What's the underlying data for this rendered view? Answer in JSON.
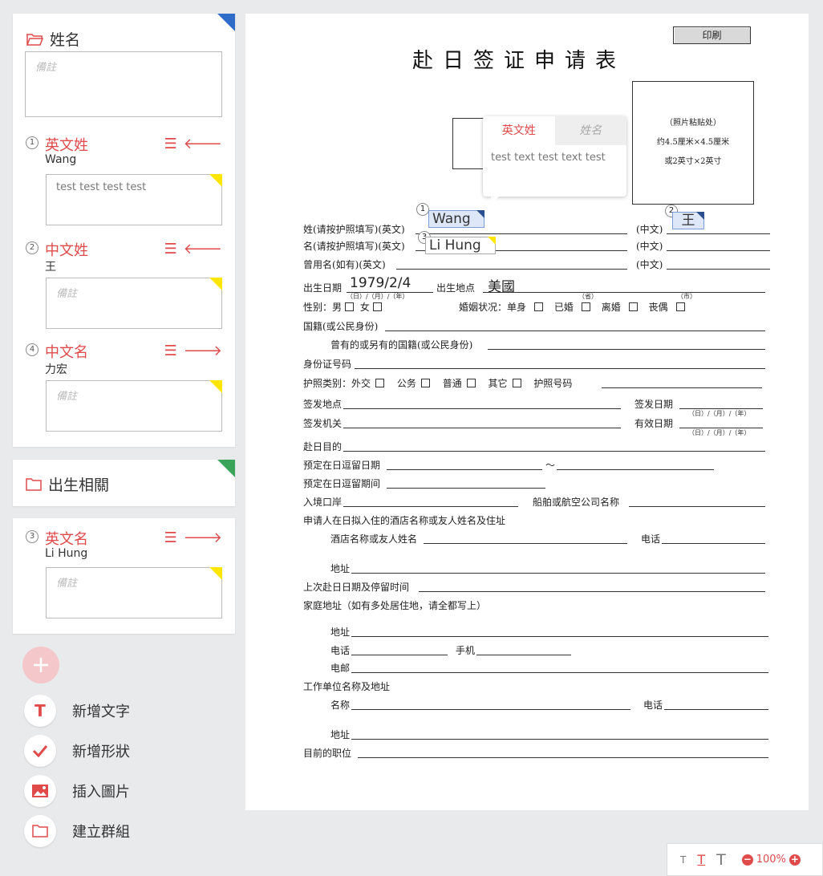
{
  "left_panel": {
    "group1": {
      "title": "姓名",
      "corner_color": "#2f6cc9",
      "note_placeholder": "備註",
      "fields": [
        {
          "num": "1",
          "name": "英文姓",
          "value": "Wang",
          "note": "test test test test",
          "note_filled": true,
          "action_icon": "arrow-left-icon"
        },
        {
          "num": "2",
          "name": "中文姓",
          "value": "王",
          "note": "備註",
          "note_filled": false,
          "action_icon": "arrow-left-icon"
        },
        {
          "num": "4",
          "name": "中文名",
          "value": "力宏",
          "note": "備註",
          "note_filled": false,
          "action_icon": "arrow-right-icon"
        }
      ]
    },
    "group2": {
      "title": "出生相關",
      "corner_color": "#3aa55a"
    },
    "single_field": {
      "num": "3",
      "name": "英文名",
      "value": "Li Hung",
      "note": "備註",
      "action_icon": "arrow-right-icon"
    },
    "actions": [
      {
        "label": "新增文字",
        "icon": "text-T-icon"
      },
      {
        "label": "新增形狀",
        "icon": "check-icon"
      },
      {
        "label": "插入圖片",
        "icon": "image-icon"
      },
      {
        "label": "建立群組",
        "icon": "folder-icon"
      }
    ]
  },
  "document": {
    "print_button": "印刷",
    "title": "赴日签证申请表",
    "photo_box": [
      "（照片粘贴处）",
      "约4.5厘米×4.5厘米",
      "或2英寸×2英寸"
    ],
    "labels": {
      "surname_en": "姓(请按护照填写)(英文)",
      "surname_cn": "(中文)",
      "given_en": "名(请按护照填写)(英文)",
      "given_cn": "(中文)",
      "former_en": "曾用名(如有)(英文)",
      "former_cn": "(中文)",
      "birth_date": "出生日期",
      "birth_place": "出生地点",
      "date_sub": "（日）/（月）/（年）",
      "prov_sub": "（省）",
      "city_sub": "（市）",
      "gender": "性别：男",
      "female": "女",
      "marital": "婚姻状况：单身",
      "married": "已婚",
      "divorced": "离婚",
      "widowed": "丧偶",
      "nationality": "国籍(或公民身份)",
      "former_nationality": "曾有的或另有的国籍(或公民身份)",
      "id_number": "身份证号码",
      "passport_type": "护照类别：外交",
      "official": "公务",
      "ordinary": "普通",
      "other": "其它",
      "passport_no": "护照号码",
      "issue_place": "签发地点",
      "issue_date": "签发日期",
      "issuing_authority": "签发机关",
      "valid_date": "有效日期",
      "dmy": "（日）/（月）/（年）",
      "purpose": "赴日目的",
      "stay_date": "预定在日逗留日期",
      "tilde": "～",
      "stay_period": "预定在日逗留期间",
      "port": "入境口岸",
      "ship": "船舶或航空公司名称",
      "hotel_title": "申请人在日拟入住的酒店名称或友人姓名及住址",
      "hotel_name": "酒店名称或友人姓名",
      "phone": "电话",
      "address": "地址",
      "last_visit": "上次赴日日期及停留时间",
      "home_address": "家庭地址（如有多处居住地，请全都写上）",
      "home_addr": "地址",
      "home_phone": "电话",
      "mobile": "手机",
      "email": "电邮",
      "work_title": "工作单位名称及地址",
      "work_name": "名称",
      "work_phone": "电话",
      "work_addr": "地址",
      "position": "目前的职位"
    },
    "handwritten": {
      "birth_date": "1979/2/4",
      "birth_place": "美國"
    },
    "overlays": [
      {
        "num": "1",
        "value": "Wang"
      },
      {
        "num": "2",
        "value": "王"
      },
      {
        "num": "3",
        "value": "Li Hung"
      }
    ],
    "popover": {
      "tab_active": "英文姓",
      "tab_inactive": "姓名",
      "text": "test text test text test"
    }
  },
  "toolbar": {
    "zoom": "100%",
    "t_small": "T",
    "t_underline": "T",
    "t_large": "T"
  }
}
